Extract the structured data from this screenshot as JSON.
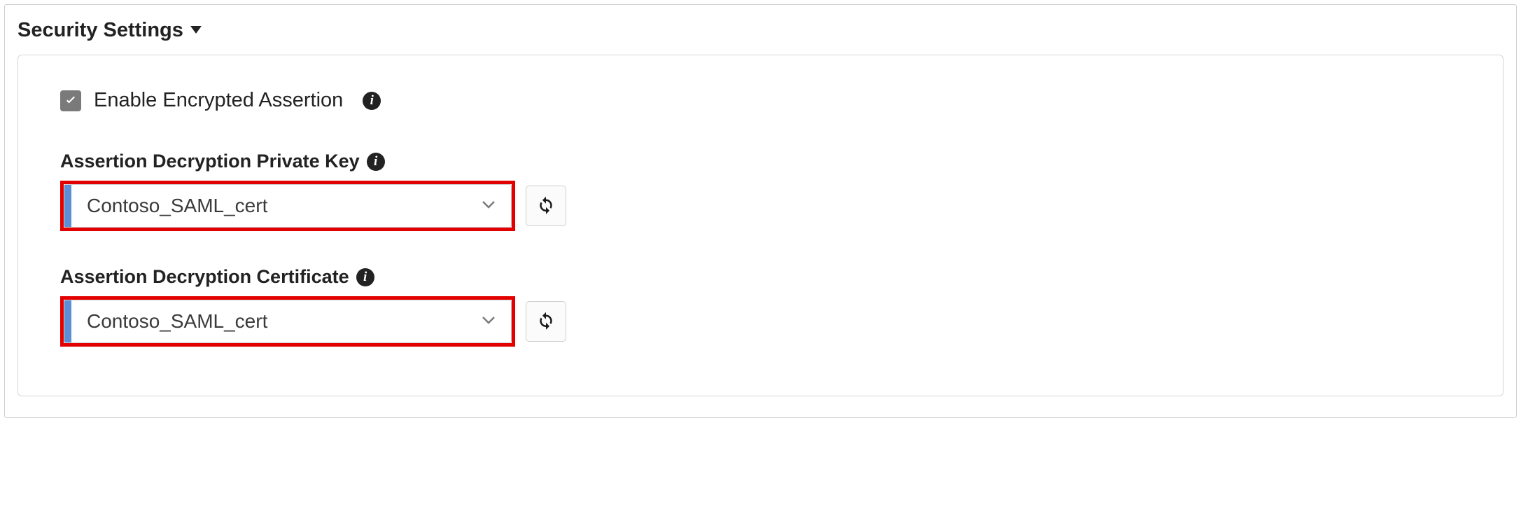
{
  "section": {
    "title": "Security Settings"
  },
  "enableEncrypted": {
    "label": "Enable Encrypted Assertion",
    "checked": true
  },
  "fields": {
    "privateKey": {
      "label": "Assertion Decryption Private Key",
      "value": "Contoso_SAML_cert"
    },
    "certificate": {
      "label": "Assertion Decryption Certificate",
      "value": "Contoso_SAML_cert"
    }
  },
  "colors": {
    "highlight": "#e20000",
    "accent": "#5b8fd6"
  }
}
